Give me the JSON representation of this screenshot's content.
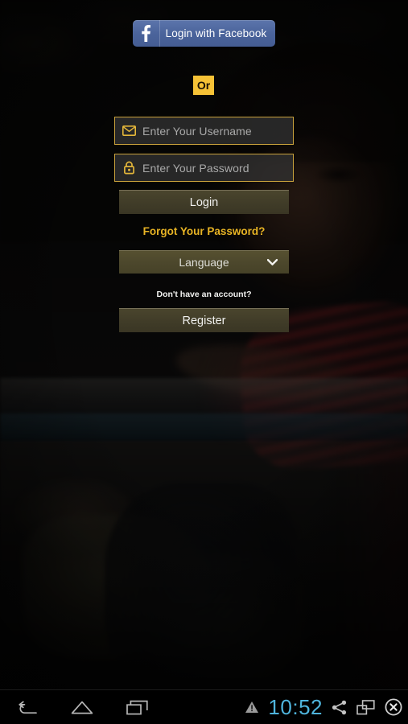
{
  "app": {
    "screen_name": "Login",
    "background_description": "darkened photograph of a seated boy with a backpack"
  },
  "colors": {
    "accent_gold": "#e8b424",
    "badge_gold": "#f6c236",
    "facebook_blue": "#4a639b",
    "field_border": "#c9a23c",
    "button_olive": "#4a452d",
    "clock_blue": "#4fb4dc"
  },
  "facebook": {
    "label": "Login with Facebook",
    "icon": "facebook-f-icon"
  },
  "divider": {
    "or_label": "Or"
  },
  "form": {
    "username": {
      "placeholder": "Enter Your Username",
      "value": "",
      "icon": "envelope-icon"
    },
    "password": {
      "placeholder": "Enter Your Password",
      "value": "",
      "icon": "lock-icon"
    },
    "login_label": "Login",
    "forgot_label": "Forgot Your Password?",
    "language": {
      "selected": "Language",
      "icon": "chevron-down-icon"
    },
    "no_account_label": "Don't have an account?",
    "register_label": "Register"
  },
  "navbar": {
    "back_icon": "back-arrow-icon",
    "home_icon": "home-icon",
    "recents_icon": "recent-apps-icon",
    "warning_icon": "warning-triangle-icon",
    "clock": "10:52",
    "share_icon": "share-icon",
    "screenshot_icon": "screen-cast-icon",
    "close_icon": "close-circle-icon"
  }
}
